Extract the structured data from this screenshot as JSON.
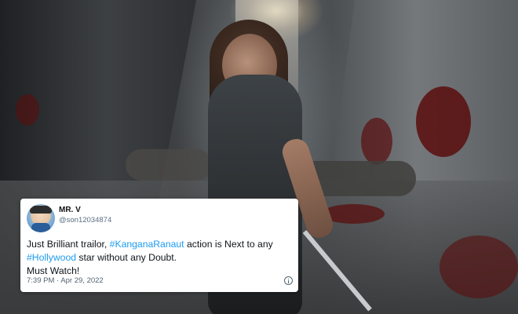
{
  "tweet": {
    "display_name": "MR. V",
    "handle": "@son12034874",
    "text_parts": {
      "p1": "Just Brilliant trailor, ",
      "tag1": "#KanganaRanaut",
      "p2": " action is Next to any",
      "tag2": "#Hollywood",
      "p3": " star without any Doubt.",
      "p4": "Must Watch!"
    },
    "timestamp": "7:39 PM · Apr 29, 2022",
    "icons": {
      "info": "info-icon",
      "avatar": "cartoon-avatar"
    },
    "colors": {
      "hashtag": "#1d9bf0",
      "meta": "#536471",
      "card_bg": "#ffffff"
    }
  }
}
